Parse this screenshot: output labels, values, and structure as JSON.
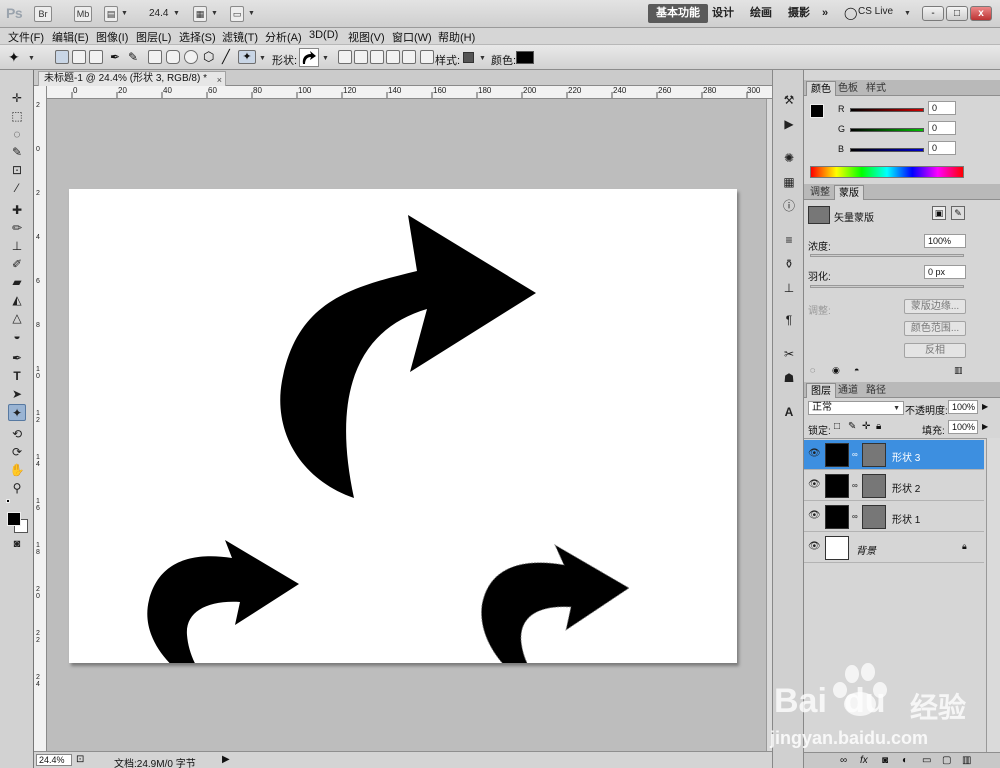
{
  "app": {
    "logo": "Ps",
    "bridge": "Br",
    "minibridge": "Mb",
    "zoom": "24.4",
    "workspaces": [
      "基本功能",
      "设计",
      "绘画",
      "摄影"
    ],
    "more": "»",
    "cslive": "CS Live",
    "window_buttons": [
      "-",
      "□",
      "x"
    ]
  },
  "menu": [
    "文件(F)",
    "编辑(E)",
    "图像(I)",
    "图层(L)",
    "选择(S)",
    "滤镜(T)",
    "分析(A)",
    "3D(D)",
    "视图(V)",
    "窗口(W)",
    "帮助(H)"
  ],
  "options": {
    "shape_label": "形状:",
    "style_label": "样式:",
    "color_label": "颜色:",
    "color": "#000000"
  },
  "document": {
    "tab_title": "未标题-1 @ 24.4% (形状 3, RGB/8) *",
    "close": "×",
    "ruler_h": [
      "0",
      "20",
      "40",
      "60",
      "80",
      "100",
      "120",
      "140",
      "160",
      "180",
      "200",
      "220",
      "240",
      "260",
      "280",
      "300"
    ],
    "ruler_v": [
      "2",
      "0",
      "2",
      "4",
      "6",
      "8",
      "10",
      "12",
      "14",
      "16",
      "18",
      "20",
      "22",
      "24"
    ],
    "shapes": [
      "arrow-large",
      "arrow-left",
      "arrow-right"
    ]
  },
  "status": {
    "zoom": "24.4%",
    "doc_info": "文档:24.9M/0 字节"
  },
  "color_panel": {
    "tabs": [
      "颜色",
      "色板",
      "样式"
    ],
    "channels": [
      {
        "label": "R",
        "value": "0",
        "color": "#c00000"
      },
      {
        "label": "G",
        "value": "0",
        "color": "#00a000"
      },
      {
        "label": "B",
        "value": "0",
        "color": "#0000c0"
      }
    ]
  },
  "mask_panel": {
    "tabs": [
      "调整",
      "蒙版"
    ],
    "title": "矢量蒙版",
    "density_label": "浓度:",
    "density_value": "100%",
    "feather_label": "羽化:",
    "feather_value": "0 px",
    "refine_label": "调整:",
    "buttons": [
      "蒙版边缘...",
      "颜色范围...",
      "反相"
    ]
  },
  "layers_panel": {
    "tabs": [
      "图层",
      "通道",
      "路径"
    ],
    "blend_mode": "正常",
    "opacity_label": "不透明度:",
    "opacity_value": "100%",
    "lock_label": "锁定:",
    "fill_label": "填充:",
    "fill_value": "100%",
    "layers": [
      {
        "name": "形状 3",
        "selected": true
      },
      {
        "name": "形状 2",
        "selected": false
      },
      {
        "name": "形状 1",
        "selected": false
      },
      {
        "name": "背景",
        "selected": false
      }
    ],
    "footer_icons": [
      "link-icon",
      "fx-icon",
      "mask-icon",
      "adjust-icon",
      "folder-icon",
      "new-layer-icon",
      "trash-icon"
    ]
  },
  "watermark": {
    "brand": "Bai",
    "brand2": "du",
    "site": "经验",
    "url": "jingyan.baidu.com"
  }
}
